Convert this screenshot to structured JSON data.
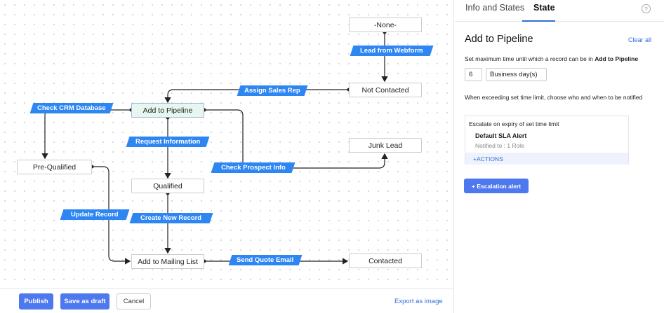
{
  "nodes": {
    "none": "-None-",
    "not_contacted": "Not Contacted",
    "add_to_pipeline": "Add to Pipeline",
    "junk_lead": "Junk Lead",
    "pre_qualified": "Pre-Qualified",
    "qualified": "Qualified",
    "add_to_mailing_list": "Add to Mailing List",
    "contacted": "Contacted"
  },
  "transitions": {
    "lead_from_webform": "Lead from Webform",
    "assign_sales_rep": "Assign Sales Rep",
    "check_crm_database": "Check CRM Database",
    "request_information": "Request Information",
    "check_prospect_info": "Check Prospect Info",
    "update_record": "Update Record",
    "create_new_record": "Create New Record",
    "send_quote_email": "Send Quote Email"
  },
  "footer": {
    "publish": "Publish",
    "save_as_draft": "Save as draft",
    "cancel": "Cancel",
    "export_as_image": "Export as image"
  },
  "panel": {
    "tabs": [
      "Info and States",
      "State"
    ],
    "active_tab": "State",
    "help_symbol": "?",
    "title": "Add to Pipeline",
    "clear_all": "Clear all",
    "time_limit_text": "Set maximum time until which a record can be in",
    "time_limit_state": "Add to Pipeline",
    "time_value": "6",
    "time_unit": "Business day(s)",
    "exceed_text": "When exceeding set time limit, choose who and when to be notified",
    "escalate_heading": "Escalate on expiry of set time limit",
    "alert_name": "Default SLA Alert",
    "notified": "Notified to : 1 Role",
    "actions_label": "+ACTIONS",
    "escalation_button": "+  Escalation alert"
  },
  "colors": {
    "accent": "#2e86f2",
    "button_primary": "#4e78ee",
    "active_node": "#e7f6ef",
    "link": "#2e6fd8"
  }
}
